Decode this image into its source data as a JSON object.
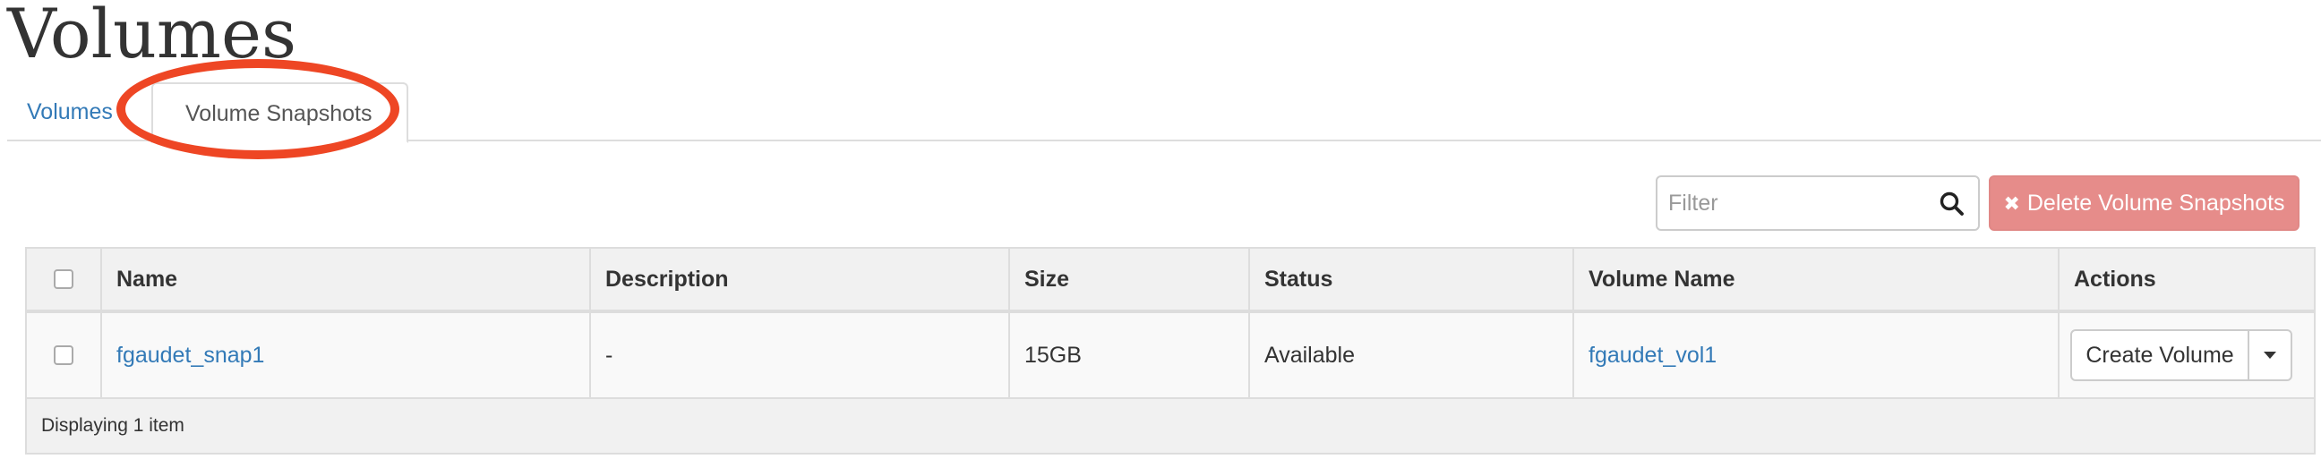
{
  "page": {
    "title": "Volumes"
  },
  "tabs": [
    {
      "label": "Volumes",
      "active": false
    },
    {
      "label": "Volume Snapshots",
      "active": true
    }
  ],
  "toolbar": {
    "filter_placeholder": "Filter",
    "filter_value": "",
    "search_icon": "search-icon",
    "delete_label": "Delete Volume Snapshots",
    "delete_icon": "close-icon",
    "delete_color": "#e68c8a"
  },
  "table": {
    "columns": [
      "Name",
      "Description",
      "Size",
      "Status",
      "Volume Name",
      "Actions"
    ],
    "rows": [
      {
        "name": "fgaudet_snap1",
        "description": "-",
        "size": "15GB",
        "status": "Available",
        "volume_name": "fgaudet_vol1",
        "action_label": "Create Volume"
      }
    ],
    "footer": "Displaying 1 item"
  },
  "colors": {
    "link": "#337ab7",
    "highlight": "#ee4624"
  }
}
